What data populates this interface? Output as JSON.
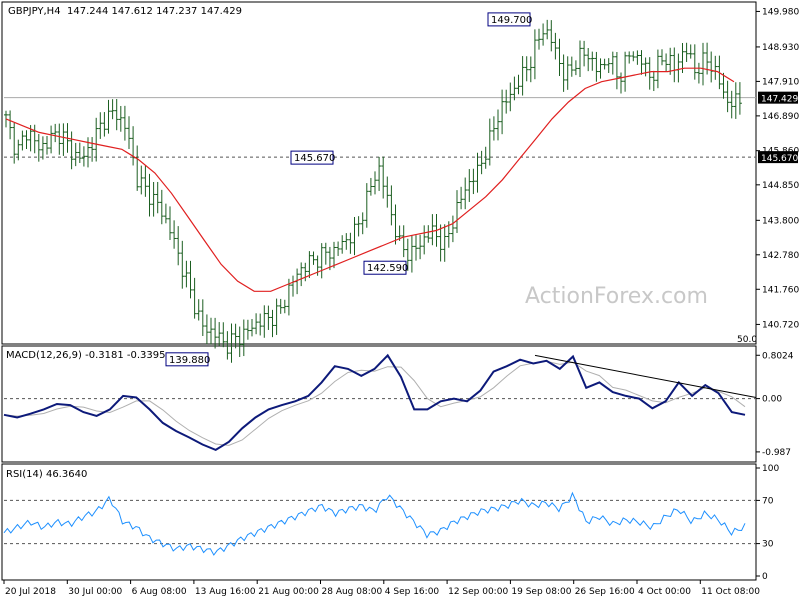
{
  "colors": {
    "price_bars": "#1b5e20",
    "ma_line": "#e02020",
    "macd_line": "#0d1a7a",
    "signal_line": "#b0b0b0",
    "rsi_line": "#1e90ff",
    "grid_dashed": "#555555",
    "label_box_border": "#000080",
    "current_price_bg": "#000000",
    "watermark": "#c8c8c8"
  },
  "watermark": "ActionForex.com",
  "chart_data": [
    {
      "type": "candlestick",
      "panel": "price",
      "title": "GBPJPY,H4",
      "ohlc_text": "147.244 147.612 147.237 147.429",
      "yticks": [
        "149.980",
        "148.930",
        "147.910",
        "146.890",
        "145.860",
        "144.850",
        "143.800",
        "142.780",
        "141.760",
        "140.720"
      ],
      "ylim": [
        140.2,
        150.2
      ],
      "level_labels": [
        "147.429",
        "145.670"
      ],
      "horizontal_level": 145.67,
      "current_price": 147.429,
      "price_series": [
        146.8,
        145.8,
        146.5,
        145.9,
        146.2,
        146.4,
        145.8,
        145.6,
        146.2,
        146.8,
        147.0,
        146.5,
        145.0,
        144.6,
        144.2,
        143.5,
        142.5,
        141.5,
        140.6,
        140.5,
        140.1,
        140.3,
        140.5,
        140.8,
        140.9,
        141.1,
        141.9,
        142.4,
        142.6,
        142.8,
        142.9,
        143.2,
        143.5,
        144.5,
        145.4,
        144.2,
        143.0,
        142.8,
        143.2,
        143.5,
        143.0,
        144.0,
        144.8,
        145.2,
        146.0,
        147.0,
        147.5,
        148.0,
        148.6,
        149.5,
        149.0,
        148.0,
        148.5,
        148.8,
        148.2,
        148.6,
        148.0,
        148.8,
        148.5,
        148.0,
        148.7,
        148.3,
        148.9,
        148.2,
        148.6,
        148.0,
        147.2,
        147.4
      ],
      "ma_series": [
        146.8,
        146.6,
        146.4,
        146.3,
        146.2,
        146.1,
        146.0,
        145.9,
        145.6,
        145.2,
        144.6,
        143.9,
        143.2,
        142.5,
        142.0,
        141.7,
        141.7,
        141.9,
        142.1,
        142.3,
        142.5,
        142.7,
        142.9,
        143.1,
        143.3,
        143.4,
        143.5,
        143.7,
        144.1,
        144.5,
        145.0,
        145.6,
        146.2,
        146.8,
        147.3,
        147.7,
        147.9,
        148.0,
        148.1,
        148.2,
        148.2,
        148.3,
        148.3,
        148.2,
        147.9
      ],
      "annotations": [
        {
          "text": "149.700",
          "value": 149.7
        },
        {
          "text": "145.670",
          "value": 145.67
        },
        {
          "text": "142.590",
          "value": 142.59
        },
        {
          "text": "139.880",
          "value": 139.88
        }
      ],
      "level_text": "50.0"
    },
    {
      "type": "line",
      "panel": "macd",
      "title": "MACD(12,26,9) -0.3181 -0.3395",
      "yticks": [
        "0.8024",
        "0.00",
        "-0.987"
      ],
      "ylim": [
        -1.1,
        0.9
      ],
      "zero_label": "0.00",
      "macd_values": [
        -0.3,
        -0.35,
        -0.28,
        -0.2,
        -0.1,
        -0.12,
        -0.25,
        -0.32,
        -0.2,
        0.05,
        0.02,
        -0.2,
        -0.45,
        -0.6,
        -0.72,
        -0.85,
        -0.95,
        -0.8,
        -0.55,
        -0.35,
        -0.2,
        -0.12,
        -0.05,
        0.05,
        0.3,
        0.6,
        0.55,
        0.42,
        0.55,
        0.8,
        0.4,
        -0.2,
        -0.2,
        -0.05,
        0.0,
        -0.05,
        0.15,
        0.5,
        0.6,
        0.72,
        0.65,
        0.7,
        0.55,
        0.78,
        0.2,
        0.3,
        0.12,
        0.05,
        0.0,
        -0.18,
        -0.05,
        0.3,
        0.05,
        0.25,
        0.1,
        -0.25,
        -0.3
      ]
    },
    {
      "type": "line",
      "panel": "rsi",
      "title": "RSI(14) 46.3640",
      "yticks": [
        "100",
        "70",
        "30",
        "0"
      ],
      "ylim": [
        0,
        100
      ],
      "rsi_values": [
        40,
        45,
        50,
        45,
        50,
        48,
        55,
        60,
        72,
        50,
        45,
        35,
        30,
        25,
        28,
        25,
        22,
        28,
        35,
        40,
        45,
        50,
        55,
        60,
        65,
        58,
        62,
        65,
        60,
        75,
        62,
        50,
        38,
        42,
        50,
        55,
        60,
        62,
        65,
        70,
        65,
        68,
        62,
        75,
        50,
        55,
        48,
        52,
        50,
        45,
        55,
        62,
        50,
        58,
        52,
        40,
        46
      ],
      "x_tick_labels": [
        "20 Jul 2018",
        "30 Jul 00:00",
        "6 Aug 08:00",
        "13 Aug 16:00",
        "21 Aug 00:00",
        "28 Aug 08:00",
        "4 Sep 16:00",
        "12 Sep 00:00",
        "19 Sep 08:00",
        "26 Sep 16:00",
        "4 Oct 00:00",
        "11 Oct 08:00"
      ]
    }
  ]
}
